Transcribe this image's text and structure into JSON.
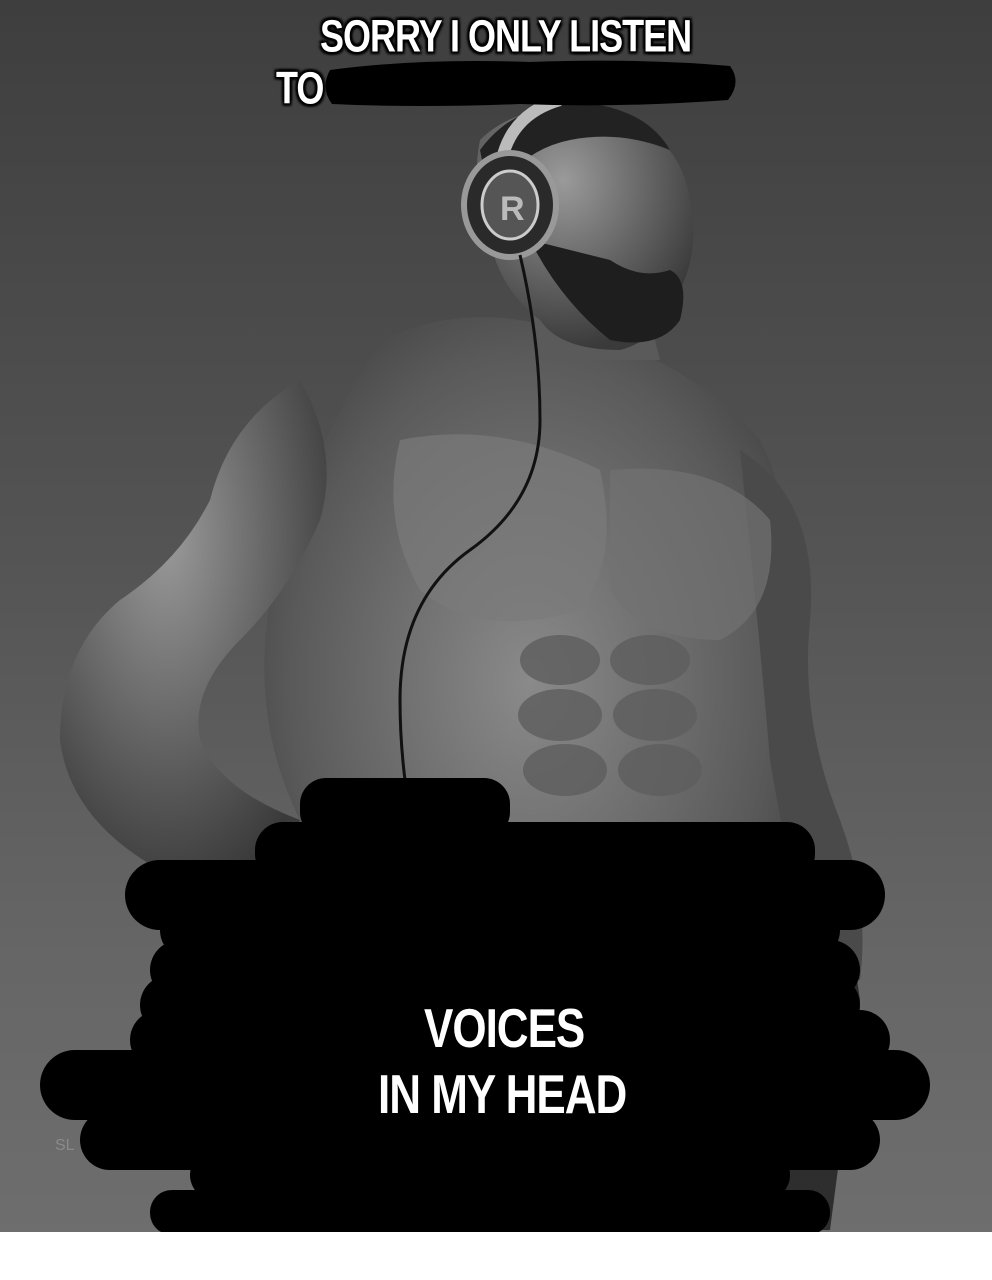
{
  "captions": {
    "top_line1": "SORRY I ONLY LISTEN",
    "top_line2": "TO",
    "bottom_line1": "VOICES",
    "bottom_line2": "IN MY HEAD"
  },
  "watermark": "SL",
  "colors": {
    "background": "#555555",
    "redaction": "#000000",
    "caption_text": "#ffffff"
  },
  "icons": {
    "headphones": "headphones-icon"
  }
}
